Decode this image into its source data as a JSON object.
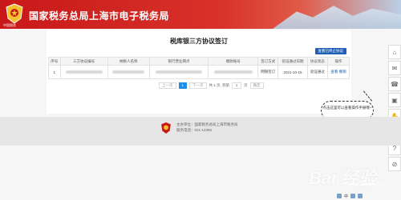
{
  "header": {
    "title": "国家税务总局上海市电子税务局",
    "emblem_caption": "中国税务"
  },
  "page": {
    "title": "税库银三方协议签订",
    "stop_link": "查看已终止协议"
  },
  "table": {
    "columns": [
      "序号",
      "三方协议编号",
      "纳税人名称",
      "银行营业网点",
      "缴款账号",
      "签订方式",
      "验证通过日期",
      "协议状态",
      "操作"
    ],
    "rows": [
      {
        "index": "1",
        "sign_method": "网银签订",
        "verify_date": "2021-10-15",
        "status": "验证通过",
        "actions": "查看  撤销"
      }
    ]
  },
  "pager": {
    "prev": "上一页",
    "current": "1",
    "next": "下一页",
    "summary": "共 1 页, 到第",
    "goto_value": "1",
    "page_unit": "页",
    "go": "确定"
  },
  "tip": {
    "text": "点击这里可以查看操作手册哦~"
  },
  "rail": {
    "icons": [
      "home-icon",
      "bell-icon",
      "phone-icon",
      "guide-icon",
      "hand-icon",
      "lock-icon",
      "help-icon",
      "compass-icon"
    ],
    "glyphs": [
      "⌂",
      "✉",
      "☎",
      "▣",
      "✋",
      "⚿",
      "?",
      "⊘"
    ]
  },
  "footer": {
    "host_label": "主办单位：",
    "host_value": "国家税务总局上海市税务局",
    "phone_label": "服务电话：",
    "phone_value": "021-12366"
  },
  "watermark": {
    "brand": "Bai 经验",
    "sub": "jingyan.baidu.com"
  },
  "taskbar": {
    "ime": "中"
  },
  "colors": {
    "header_red": "#c81818",
    "link_blue": "#1f5fb4",
    "pager_active": "#1f8ce6"
  }
}
